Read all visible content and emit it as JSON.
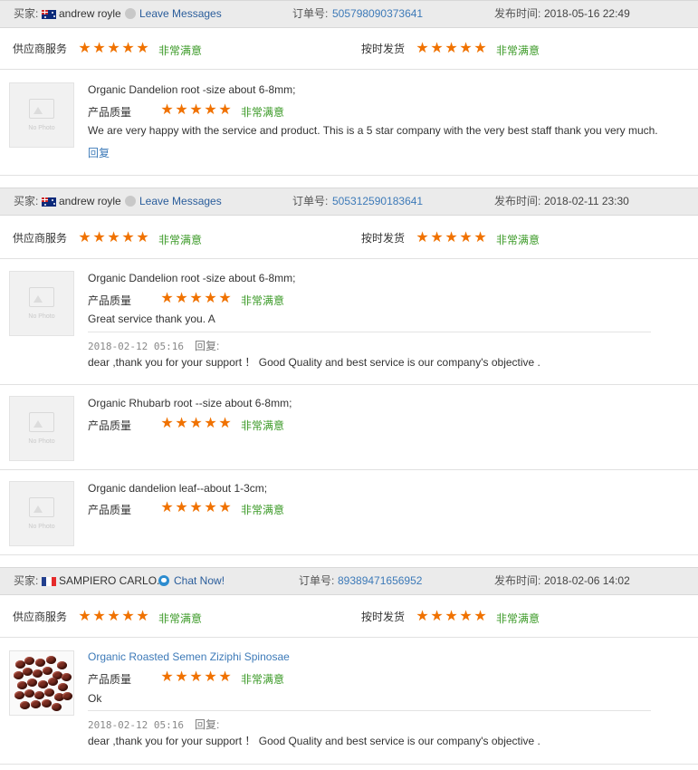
{
  "labels": {
    "buyer": "买家:",
    "order_no": "订单号:",
    "published": "发布时间:",
    "supplier_service": "供应商服务",
    "on_time_shipping": "按时发货",
    "product_quality": "产品质量",
    "very_satisfied": "非常满意",
    "reply": "回复",
    "replied": "回复:",
    "no_photo": "No Photo",
    "star": "★"
  },
  "colors": {
    "star": "#f07200",
    "satisfied": "#3b9a27",
    "link": "#3d7ab8",
    "header_bg": "#ebebeb"
  },
  "reviews": [
    {
      "buyer": {
        "country_flag": "flag-australia-icon",
        "name": "andrew royle",
        "contact": "Leave Messages"
      },
      "order_no": "505798090373641",
      "date": "2018-05-16 22:49",
      "supplier_service_rating": 5,
      "shipping_rating": 5,
      "items": [
        {
          "product": "Organic Dandelion root -size about 6-8mm;",
          "quality_rating": 5,
          "comment": "We are very happy with the service and product. This is a 5 star company with the very best staff thank you very much."
        }
      ]
    },
    {
      "buyer": {
        "country_flag": "flag-australia-icon",
        "name": "andrew royle",
        "contact": "Leave Messages"
      },
      "order_no": "505312590183641",
      "date": "2018-02-11 23:30",
      "supplier_service_rating": 5,
      "shipping_rating": 5,
      "items": [
        {
          "product": "Organic Dandelion root -size about 6-8mm;",
          "quality_rating": 5,
          "comment": "Great service thank you. A",
          "reply": {
            "date": "2018-02-12 05:16",
            "text": "dear ,thank you for your support ！ Good Quality and best service is our company's objective ."
          }
        },
        {
          "product": "Organic Rhubarb root --size about 6-8mm;",
          "quality_rating": 5
        },
        {
          "product": "Organic dandelion leaf--about 1-3cm;",
          "quality_rating": 5
        }
      ]
    },
    {
      "buyer": {
        "country_flag": "flag-france-icon",
        "name": "SAMPIERO CARLO...",
        "contact": "Chat Now!"
      },
      "order_no": "89389471656952",
      "date": "2018-02-06 14:02",
      "supplier_service_rating": 5,
      "shipping_rating": 5,
      "items": [
        {
          "product": "Organic Roasted Semen Ziziphi Spinosae",
          "quality_rating": 5,
          "comment": "Ok",
          "reply": {
            "date": "2018-02-12 05:16",
            "text": "dear ,thank you for your support ！ Good Quality and best service is our company's objective ."
          }
        }
      ]
    }
  ]
}
